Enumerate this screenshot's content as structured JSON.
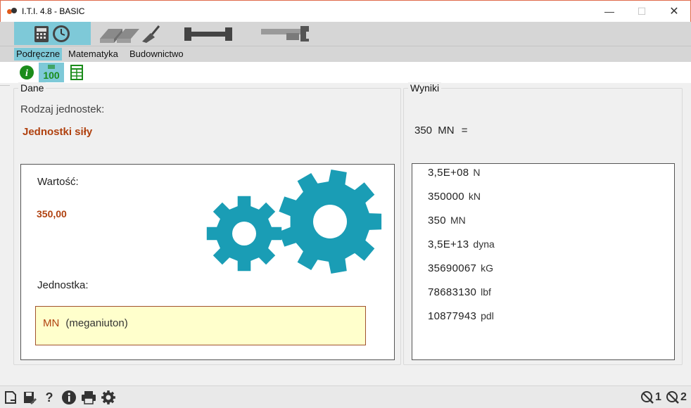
{
  "window": {
    "title": "I.T.I. 4.8 - BASIC",
    "minimize": "—",
    "maximize": "☐",
    "close": "✕"
  },
  "modules": [
    {
      "name": "calculator-clock-icon",
      "active": true
    },
    {
      "name": "bricks-trowel-icon",
      "active": false
    },
    {
      "name": "wrench-icon",
      "active": false
    },
    {
      "name": "pipe-wrench-icon",
      "active": false
    }
  ],
  "tabs": [
    {
      "label": "Podręczne",
      "active": true
    },
    {
      "label": "Matematyka",
      "active": false
    },
    {
      "label": "Budownictwo",
      "active": false
    }
  ],
  "sub_tools": [
    {
      "name": "info-green-icon",
      "active": false
    },
    {
      "name": "percent-100-icon",
      "active": true,
      "label": "100"
    },
    {
      "name": "spreadsheet-icon",
      "active": false
    }
  ],
  "dane": {
    "group_label": "Dane",
    "rodzaj_label": "Rodzaj jednostek:",
    "rodzaj_value": "Jednostki siły",
    "wartosc_label": "Wartość:",
    "wartosc_value": "350,00",
    "jednostka_label": "Jednostka:",
    "unit_symbol": "MN",
    "unit_name": "(meganiuton)",
    "gear_color": "#1a9db5"
  },
  "wyniki": {
    "group_label": "Wyniki",
    "header_value": "350",
    "header_unit": "MN",
    "header_eq": "=",
    "results": [
      {
        "value": "3,5E+08",
        "unit": "N"
      },
      {
        "value": "350000",
        "unit": "kN"
      },
      {
        "value": "350",
        "unit": "MN"
      },
      {
        "value": "3,5E+13",
        "unit": "dyna"
      },
      {
        "value": "35690067",
        "unit": "kG"
      },
      {
        "value": "78683130",
        "unit": "lbf"
      },
      {
        "value": "10877943",
        "unit": "pdl"
      }
    ]
  },
  "statusbar": {
    "tools": [
      "new-document-icon",
      "save-edit-icon",
      "help-icon",
      "info-icon",
      "print-icon",
      "settings-gear-icon"
    ],
    "help_glyph": "?",
    "counter1": "1",
    "counter2": "2"
  }
}
